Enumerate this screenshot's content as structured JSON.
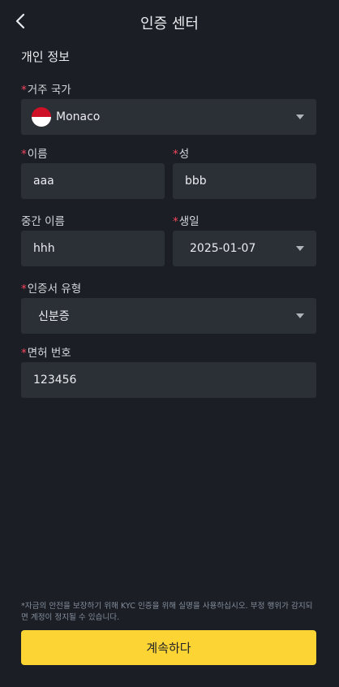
{
  "header": {
    "title": "인증 센터"
  },
  "section_title": "개인 정보",
  "form": {
    "country": {
      "required_mark": "*",
      "label": "거주 국가",
      "value": "Monaco"
    },
    "first_name": {
      "required_mark": "*",
      "label": "이름",
      "value": "aaa"
    },
    "last_name": {
      "required_mark": "*",
      "label": "성",
      "value": "bbb"
    },
    "middle_name": {
      "label": "중간 이름",
      "value": "hhh"
    },
    "birthday": {
      "required_mark": "*",
      "label": "생일",
      "value": "2025-01-07"
    },
    "id_type": {
      "required_mark": "*",
      "label": "인증서 유형",
      "value": "신분증"
    },
    "license_number": {
      "required_mark": "*",
      "label": "면허 번호",
      "value": "123456"
    }
  },
  "disclaimer": "*자금의 안전을 보장하기 위해 KYC 인증을 위해 실명을 사용하십시오. 부정 행위가 감지되면 계정이 정지될 수 있습니다.",
  "continue_label": "계속하다",
  "colors": {
    "accent": "#fcd535",
    "required": "#f6465d",
    "background": "#1b1e25",
    "field": "#2b2f36"
  }
}
